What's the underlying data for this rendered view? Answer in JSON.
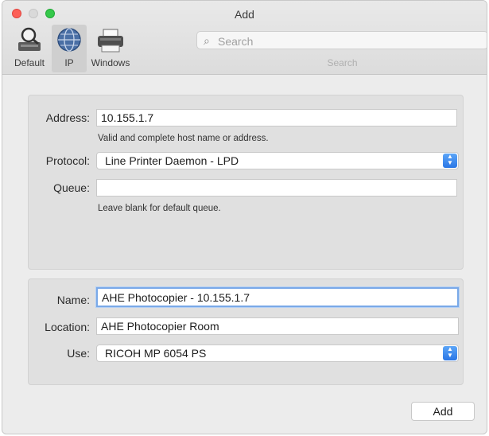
{
  "window": {
    "title": "Add"
  },
  "toolbar": {
    "tabs": [
      {
        "label": "Default",
        "icon": "magnifier-printer-icon"
      },
      {
        "label": "IP",
        "icon": "globe-icon",
        "selected": true
      },
      {
        "label": "Windows",
        "icon": "printer-icon"
      }
    ],
    "search": {
      "placeholder": "Search",
      "caption": "Search"
    }
  },
  "form": {
    "address": {
      "label": "Address:",
      "value": "10.155.1.7",
      "hint": "Valid and complete host name or address."
    },
    "protocol": {
      "label": "Protocol:",
      "value": "Line Printer Daemon - LPD"
    },
    "queue": {
      "label": "Queue:",
      "value": "",
      "hint": "Leave blank for default queue."
    },
    "name": {
      "label": "Name:",
      "value": "AHE Photocopier - 10.155.1.7"
    },
    "location": {
      "label": "Location:",
      "value": "AHE Photocopier Room"
    },
    "use": {
      "label": "Use:",
      "value": "RICOH MP 6054 PS"
    }
  },
  "footer": {
    "add_label": "Add"
  },
  "colors": {
    "accent": "#2a76e6",
    "focus_ring": "#7aa9e8"
  }
}
